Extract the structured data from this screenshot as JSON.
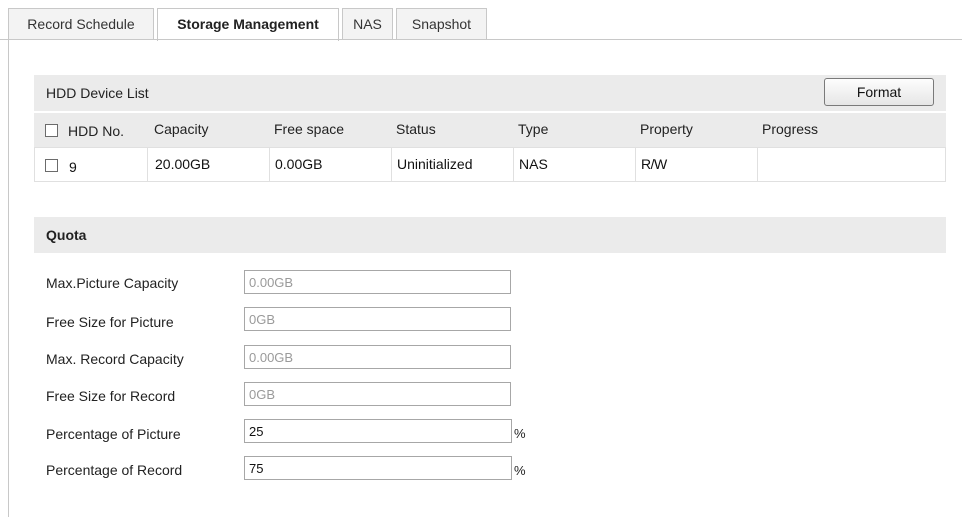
{
  "tabs": [
    "Record Schedule",
    "Storage Management",
    "NAS",
    "Snapshot"
  ],
  "active_tab": "Storage Management",
  "hdd": {
    "title": "HDD Device List",
    "format_label": "Format",
    "columns": [
      "HDD No.",
      "Capacity",
      "Free space",
      "Status",
      "Type",
      "Property",
      "Progress"
    ],
    "rows": [
      {
        "no": "9",
        "capacity": "20.00GB",
        "free": "0.00GB",
        "status": "Uninitialized",
        "type": "NAS",
        "property": "R/W",
        "progress": ""
      }
    ]
  },
  "quota": {
    "title": "Quota",
    "fields": [
      {
        "label": "Max.Picture Capacity",
        "value": "0.00GB",
        "editable": false
      },
      {
        "label": "Free Size for Picture",
        "value": "0GB",
        "editable": false
      },
      {
        "label": "Max. Record Capacity",
        "value": "0.00GB",
        "editable": false
      },
      {
        "label": "Free Size for Record",
        "value": "0GB",
        "editable": false
      },
      {
        "label": "Percentage of Picture",
        "value": "25",
        "editable": true,
        "unit": "%"
      },
      {
        "label": "Percentage of Record",
        "value": "75",
        "editable": true,
        "unit": "%"
      }
    ]
  }
}
